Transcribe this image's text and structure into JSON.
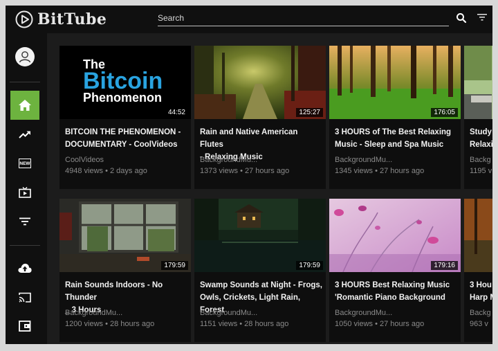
{
  "header": {
    "logo_text": "BitTube",
    "search_placeholder": "Search"
  },
  "sidebar": {
    "items": [
      {
        "name": "user-avatar",
        "icon": "user-icon"
      },
      {
        "name": "home",
        "icon": "home-icon"
      },
      {
        "name": "trending",
        "icon": "trending-icon"
      },
      {
        "name": "new",
        "icon": "new-icon",
        "label": "NEW"
      },
      {
        "name": "subscriptions",
        "icon": "tv-icon"
      },
      {
        "name": "filter",
        "icon": "filter-icon"
      },
      {
        "name": "upload",
        "icon": "cloud-upload-icon"
      },
      {
        "name": "cast",
        "icon": "cast-icon"
      },
      {
        "name": "wallet",
        "icon": "wallet-icon"
      }
    ],
    "active_color": "#6db33f"
  },
  "thumbnail_text": {
    "line1": "The",
    "line2": "Bitcoin",
    "line3": "Phenomenon"
  },
  "videos": [
    {
      "title": "BITCOIN THE PHENOMENON -\nDOCUMENTARY - CoolVideos",
      "channel": "CoolVideos",
      "meta": "4948 views • 2 days ago",
      "duration": "44:52"
    },
    {
      "title": "Rain and Native American Flutes\n- Relaxing Music",
      "channel": "BackgroundMu...",
      "meta": "1373 views • 27 hours ago",
      "duration": "125:27"
    },
    {
      "title": "3 HOURS of The Best Relaxing\nMusic - Sleep and Spa Music",
      "channel": "BackgroundMu...",
      "meta": "1345 views • 27 hours ago",
      "duration": "176:05"
    },
    {
      "title": "Study\nRelaxi",
      "channel": "Backg",
      "meta": "1195 v",
      "duration": ""
    },
    {
      "title": "Rain Sounds Indoors - No Thunder\n_ 3 Hours",
      "channel": "BackgroundMu...",
      "meta": "1200 views • 28 hours ago",
      "duration": "179:59"
    },
    {
      "title": "Swamp Sounds at Night - Frogs,\nOwls, Crickets, Light Rain, Forest",
      "channel": "BackgroundMu...",
      "meta": "1151 views • 28 hours ago",
      "duration": "179:59"
    },
    {
      "title": "3 HOURS Best Relaxing Music\n'Romantic Piano Background",
      "channel": "BackgroundMu...",
      "meta": "1050 views • 27 hours ago",
      "duration": "179:16"
    },
    {
      "title": "3 Hou\nHarp M",
      "channel": "Backg",
      "meta": "963 v",
      "duration": ""
    }
  ]
}
